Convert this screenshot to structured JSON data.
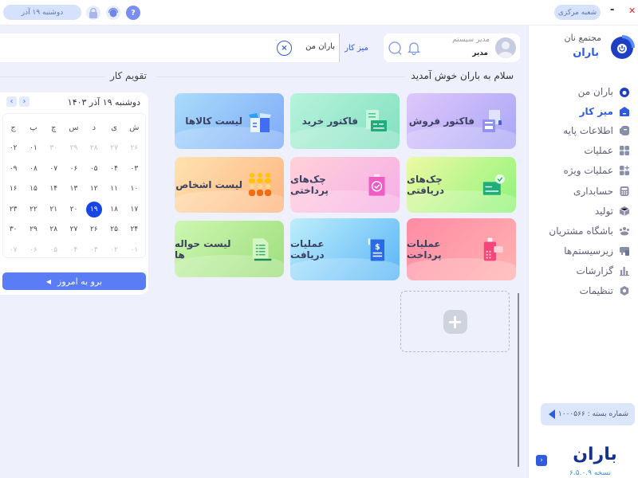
{
  "topbar": {
    "date_label": "دوشنبه ۱۹ آذر",
    "branch_label": "شعبه مرکزی",
    "minimize_label": "-",
    "close_label": "✕"
  },
  "brand": {
    "subtitle": "مجتمع نان",
    "name": "باران",
    "logo_text": "باران",
    "version": "نسخه ۶.۵.۰.۹"
  },
  "sidebar": {
    "items": [
      {
        "label": "باران من",
        "icon": "baran-logo-icon"
      },
      {
        "label": "میز کار",
        "icon": "desk-icon",
        "active": true
      },
      {
        "label": "اطلاعات پایه",
        "icon": "basic-info-icon"
      },
      {
        "label": "عملیات",
        "icon": "operations-grid-icon"
      },
      {
        "label": "عملیات ویژه",
        "icon": "special-operations-icon"
      },
      {
        "label": "حسابداری",
        "icon": "calculator-icon"
      },
      {
        "label": "تولید",
        "icon": "box-icon"
      },
      {
        "label": "باشگاه مشتریان",
        "icon": "customers-club-icon"
      },
      {
        "label": "زیرسیستم‌ها",
        "icon": "subsystems-icon"
      },
      {
        "label": "گزارشات",
        "icon": "bar-chart-icon"
      },
      {
        "label": "تنظیمات",
        "icon": "settings-icon"
      }
    ],
    "package_label": "شماره بسته : ۱۰۰۰۵۶۶"
  },
  "header": {
    "user_role": "مدیر سیستم",
    "user_name": "مدیر",
    "breadcrumb_current": "میز کار",
    "breadcrumb_tab": "باران من"
  },
  "main": {
    "welcome_title": "سلام به باران خوش آمدید",
    "cards": [
      {
        "label": "فاکتور فروش",
        "icon": "sales-invoice-icon"
      },
      {
        "label": "فاکتور خرید",
        "icon": "purchase-invoice-icon"
      },
      {
        "label": "لیست کالاها",
        "icon": "goods-list-icon"
      },
      {
        "label": "چک‌های دریافتی",
        "icon": "received-checks-icon"
      },
      {
        "label": "چک‌های پرداختی",
        "icon": "paid-checks-icon"
      },
      {
        "label": "لیست اشخاص",
        "icon": "people-list-icon"
      },
      {
        "label": "عملیات پرداخت",
        "icon": "payment-operations-icon"
      },
      {
        "label": "عملیات دریافت",
        "icon": "receive-operations-icon"
      },
      {
        "label": "لیست حواله ها",
        "icon": "transfers-list-icon"
      }
    ],
    "add_tile_icon": "plus-icon"
  },
  "calendar": {
    "title": "تقویم کار",
    "current_date": "دوشنبه ۱۹ آذر ۱۴۰۳",
    "weekdays": [
      "ش",
      "ی",
      "د",
      "س",
      "چ",
      "پ",
      "ج"
    ],
    "weeks": [
      [
        {
          "d": "۲۶",
          "m": true
        },
        {
          "d": "۲۷",
          "m": true
        },
        {
          "d": "۲۸",
          "m": true
        },
        {
          "d": "۲۹",
          "m": true
        },
        {
          "d": "۳۰",
          "m": true
        },
        {
          "d": "۰۱"
        },
        {
          "d": "۰۲"
        }
      ],
      [
        {
          "d": "۰۳"
        },
        {
          "d": "۰۴"
        },
        {
          "d": "۰۵"
        },
        {
          "d": "۰۶"
        },
        {
          "d": "۰۷"
        },
        {
          "d": "۰۸"
        },
        {
          "d": "۰۹"
        }
      ],
      [
        {
          "d": "۱۰"
        },
        {
          "d": "۱۱"
        },
        {
          "d": "۱۲"
        },
        {
          "d": "۱۳"
        },
        {
          "d": "۱۴"
        },
        {
          "d": "۱۵"
        },
        {
          "d": "۱۶"
        }
      ],
      [
        {
          "d": "۱۷"
        },
        {
          "d": "۱۸"
        },
        {
          "d": "۱۹",
          "today": true
        },
        {
          "d": "۲۰"
        },
        {
          "d": "۲۱"
        },
        {
          "d": "۲۲"
        },
        {
          "d": "۲۳"
        }
      ],
      [
        {
          "d": "۲۴"
        },
        {
          "d": "۲۵"
        },
        {
          "d": "۲۶"
        },
        {
          "d": "۲۷"
        },
        {
          "d": "۲۸"
        },
        {
          "d": "۲۹"
        },
        {
          "d": "۳۰"
        }
      ],
      [
        {
          "d": "۰۱",
          "m": true
        },
        {
          "d": "۰۲",
          "m": true
        },
        {
          "d": "۰۳",
          "m": true
        },
        {
          "d": "۰۴",
          "m": true
        },
        {
          "d": "۰۵",
          "m": true
        },
        {
          "d": "۰۶",
          "m": true
        },
        {
          "d": "۰۷",
          "m": true
        }
      ]
    ],
    "go_today_label": "برو به امروز"
  },
  "colors": {
    "accent": "#2f5be0",
    "today": "#1846e6",
    "button": "#5a7cf5"
  }
}
